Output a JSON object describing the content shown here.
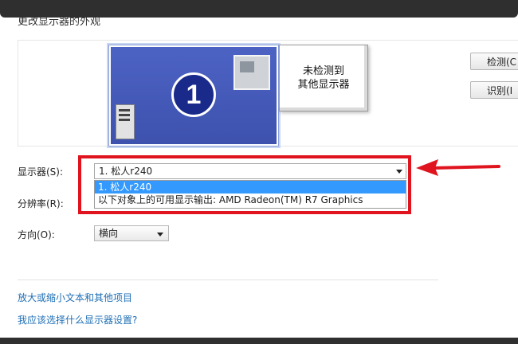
{
  "window": {
    "heading": "更改显示器的外观"
  },
  "preview": {
    "monitor_primary_number": "1",
    "monitor_secondary_text_line1": "未检测到",
    "monitor_secondary_text_line2": "其他显示器"
  },
  "buttons": {
    "detect": "检测(C",
    "identify": "识别(I"
  },
  "form": {
    "display_label": "显示器(S):",
    "display_value": "1. 松人r240",
    "display_options": [
      "1. 松人r240",
      "以下对象上的可用显示输出: AMD Radeon(TM) R7 Graphics"
    ],
    "resolution_label": "分辨率(R):",
    "orientation_label": "方向(O):",
    "orientation_value": "横向"
  },
  "links": {
    "enlarge_text": "放大或缩小文本和其他项目",
    "which_settings": "我应该选择什么显示器设置?"
  },
  "colors": {
    "highlight": "#e0141e",
    "selection": "#3399ff",
    "link": "#1f6fb5"
  }
}
